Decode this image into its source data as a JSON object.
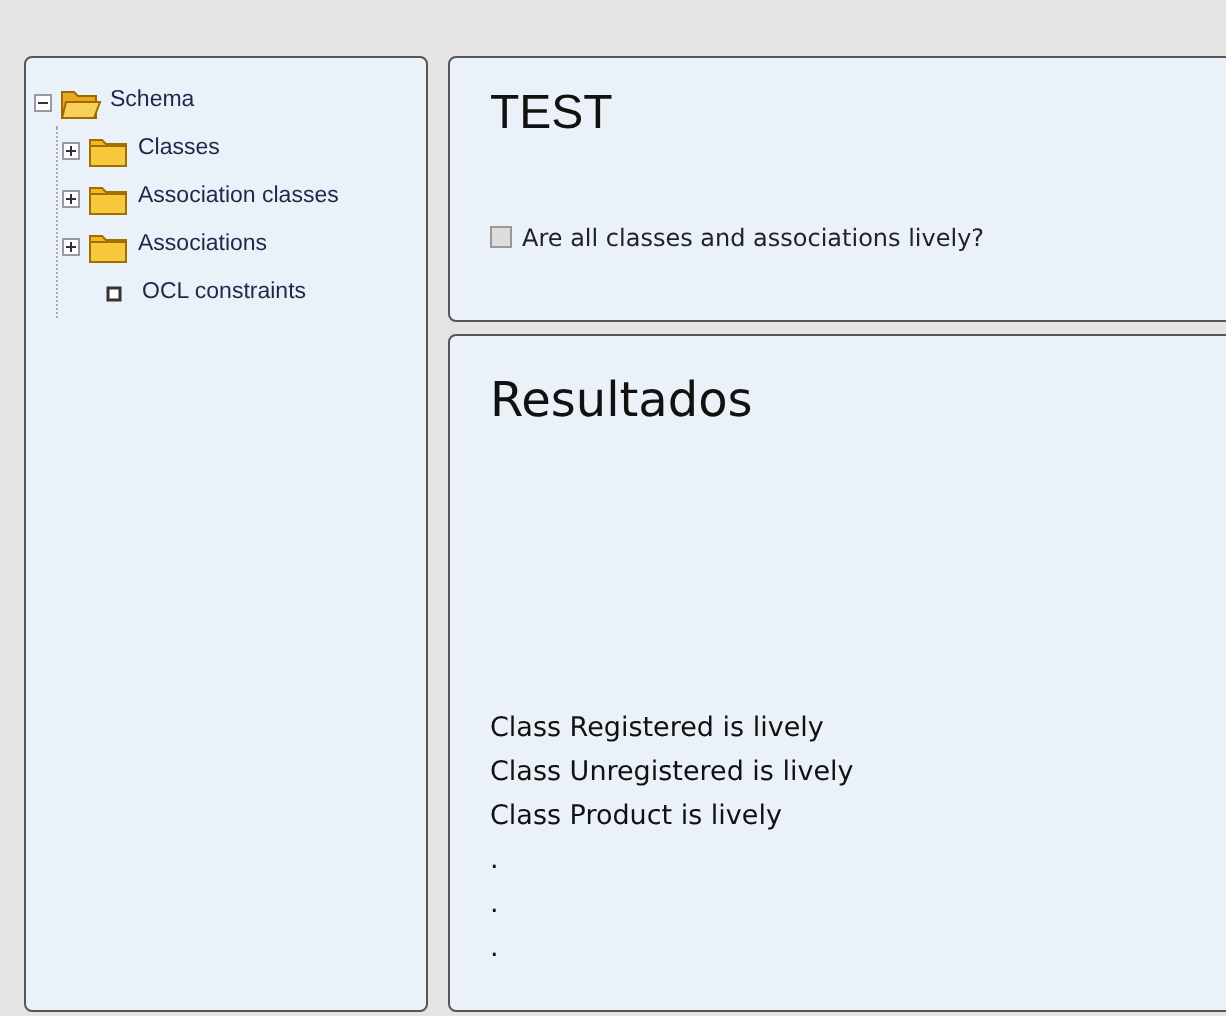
{
  "tree": [
    {
      "label": "Schema",
      "kind": "folder",
      "expanded": true,
      "children": [
        {
          "label": "Classes",
          "kind": "folder",
          "expanded": false
        },
        {
          "label": "Association classes",
          "kind": "folder",
          "expanded": false
        },
        {
          "label": "Associations",
          "kind": "folder",
          "expanded": false
        },
        {
          "label": "OCL constraints",
          "kind": "leaf"
        }
      ]
    }
  ],
  "test_panel": {
    "title": "TEST",
    "checkbox": {
      "label": "Are all classes and associations lively?",
      "checked": false
    }
  },
  "results_panel": {
    "title": "Resultados",
    "lines": [
      "Class Registered is lively",
      "Class Unregistered is lively",
      "Class Product is lively",
      ".",
      ".",
      "."
    ]
  }
}
